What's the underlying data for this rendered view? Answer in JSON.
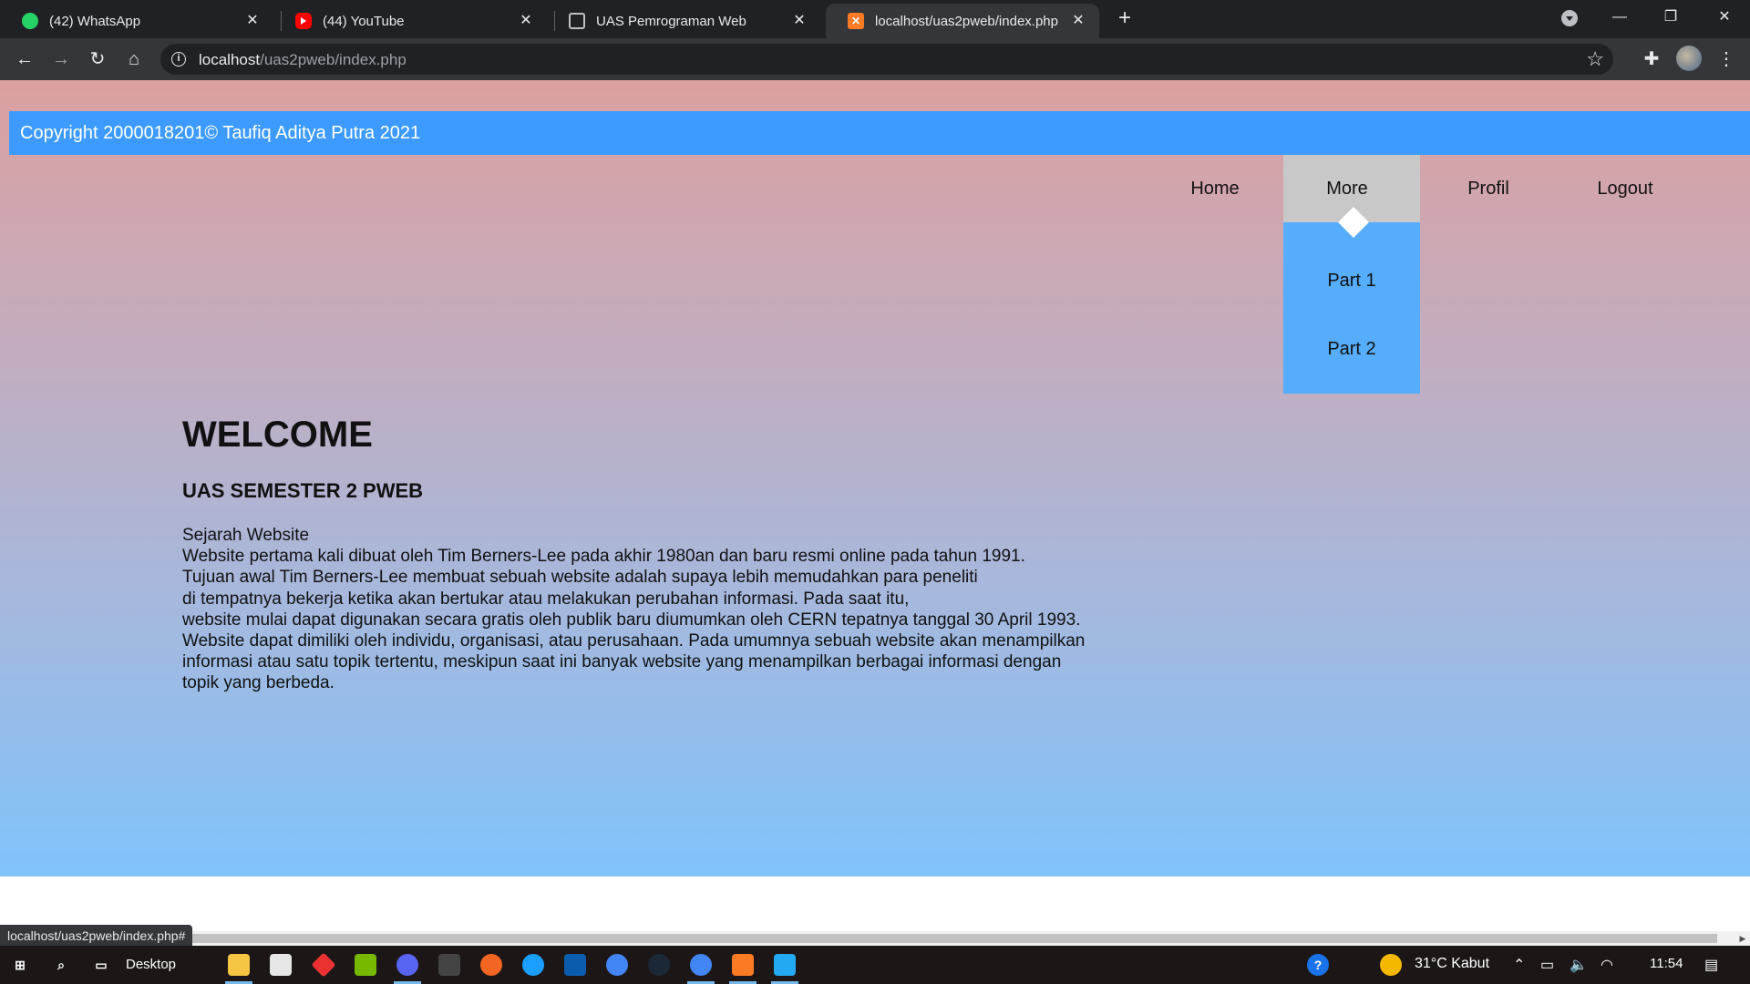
{
  "browser": {
    "tabs": [
      {
        "title": "(42) WhatsApp",
        "icon": "whatsapp-icon",
        "active": false
      },
      {
        "title": "(44) YouTube",
        "icon": "youtube-icon",
        "active": false
      },
      {
        "title": "UAS Pemrograman Web",
        "icon": "page-icon",
        "active": false
      },
      {
        "title": "localhost/uas2pweb/index.php",
        "icon": "xampp-icon",
        "active": true
      }
    ],
    "url_host": "localhost",
    "url_path": "/uas2pweb/index.php",
    "status_url": "localhost/uas2pweb/index.php#"
  },
  "page": {
    "copyright": "Copyright 2000018201© Taufiq Aditya Putra 2021",
    "nav": [
      {
        "label": "Home",
        "open": false
      },
      {
        "label": "More",
        "open": true
      },
      {
        "label": "Profil",
        "open": false
      },
      {
        "label": "Logout",
        "open": false
      }
    ],
    "submenu": [
      "Part 1",
      "Part 2"
    ],
    "welcome": "WELCOME",
    "subtitle": "UAS SEMESTER 2 PWEB",
    "body_lines": [
      "Sejarah Website",
      "Website pertama kali dibuat oleh Tim Berners-Lee pada akhir 1980an dan baru resmi online pada tahun 1991.",
      "Tujuan awal Tim Berners-Lee membuat sebuah website adalah supaya lebih memudahkan para peneliti",
      "di tempatnya bekerja ketika akan bertukar atau melakukan perubahan informasi. Pada saat itu,",
      "website mulai dapat digunakan secara gratis oleh publik baru diumumkan oleh CERN tepatnya tanggal 30 April 1993.",
      "Website dapat dimiliki oleh individu, organisasi, atau perusahaan. Pada umumnya sebuah website akan menampilkan",
      "informasi atau satu topik tertentu, meskipun saat ini banyak website yang menampilkan berbagai informasi dengan",
      "topik yang berbeda."
    ],
    "colors": {
      "header_bar": "#3d9bff",
      "submenu": "#55adfb",
      "more_open": "#c8c8c8",
      "gradient_top": "#dba0a0",
      "gradient_bottom": "#80c3fb"
    }
  },
  "taskbar": {
    "desktop_label": "Desktop",
    "weather": "31°C  Kabut",
    "time": "11:54"
  }
}
